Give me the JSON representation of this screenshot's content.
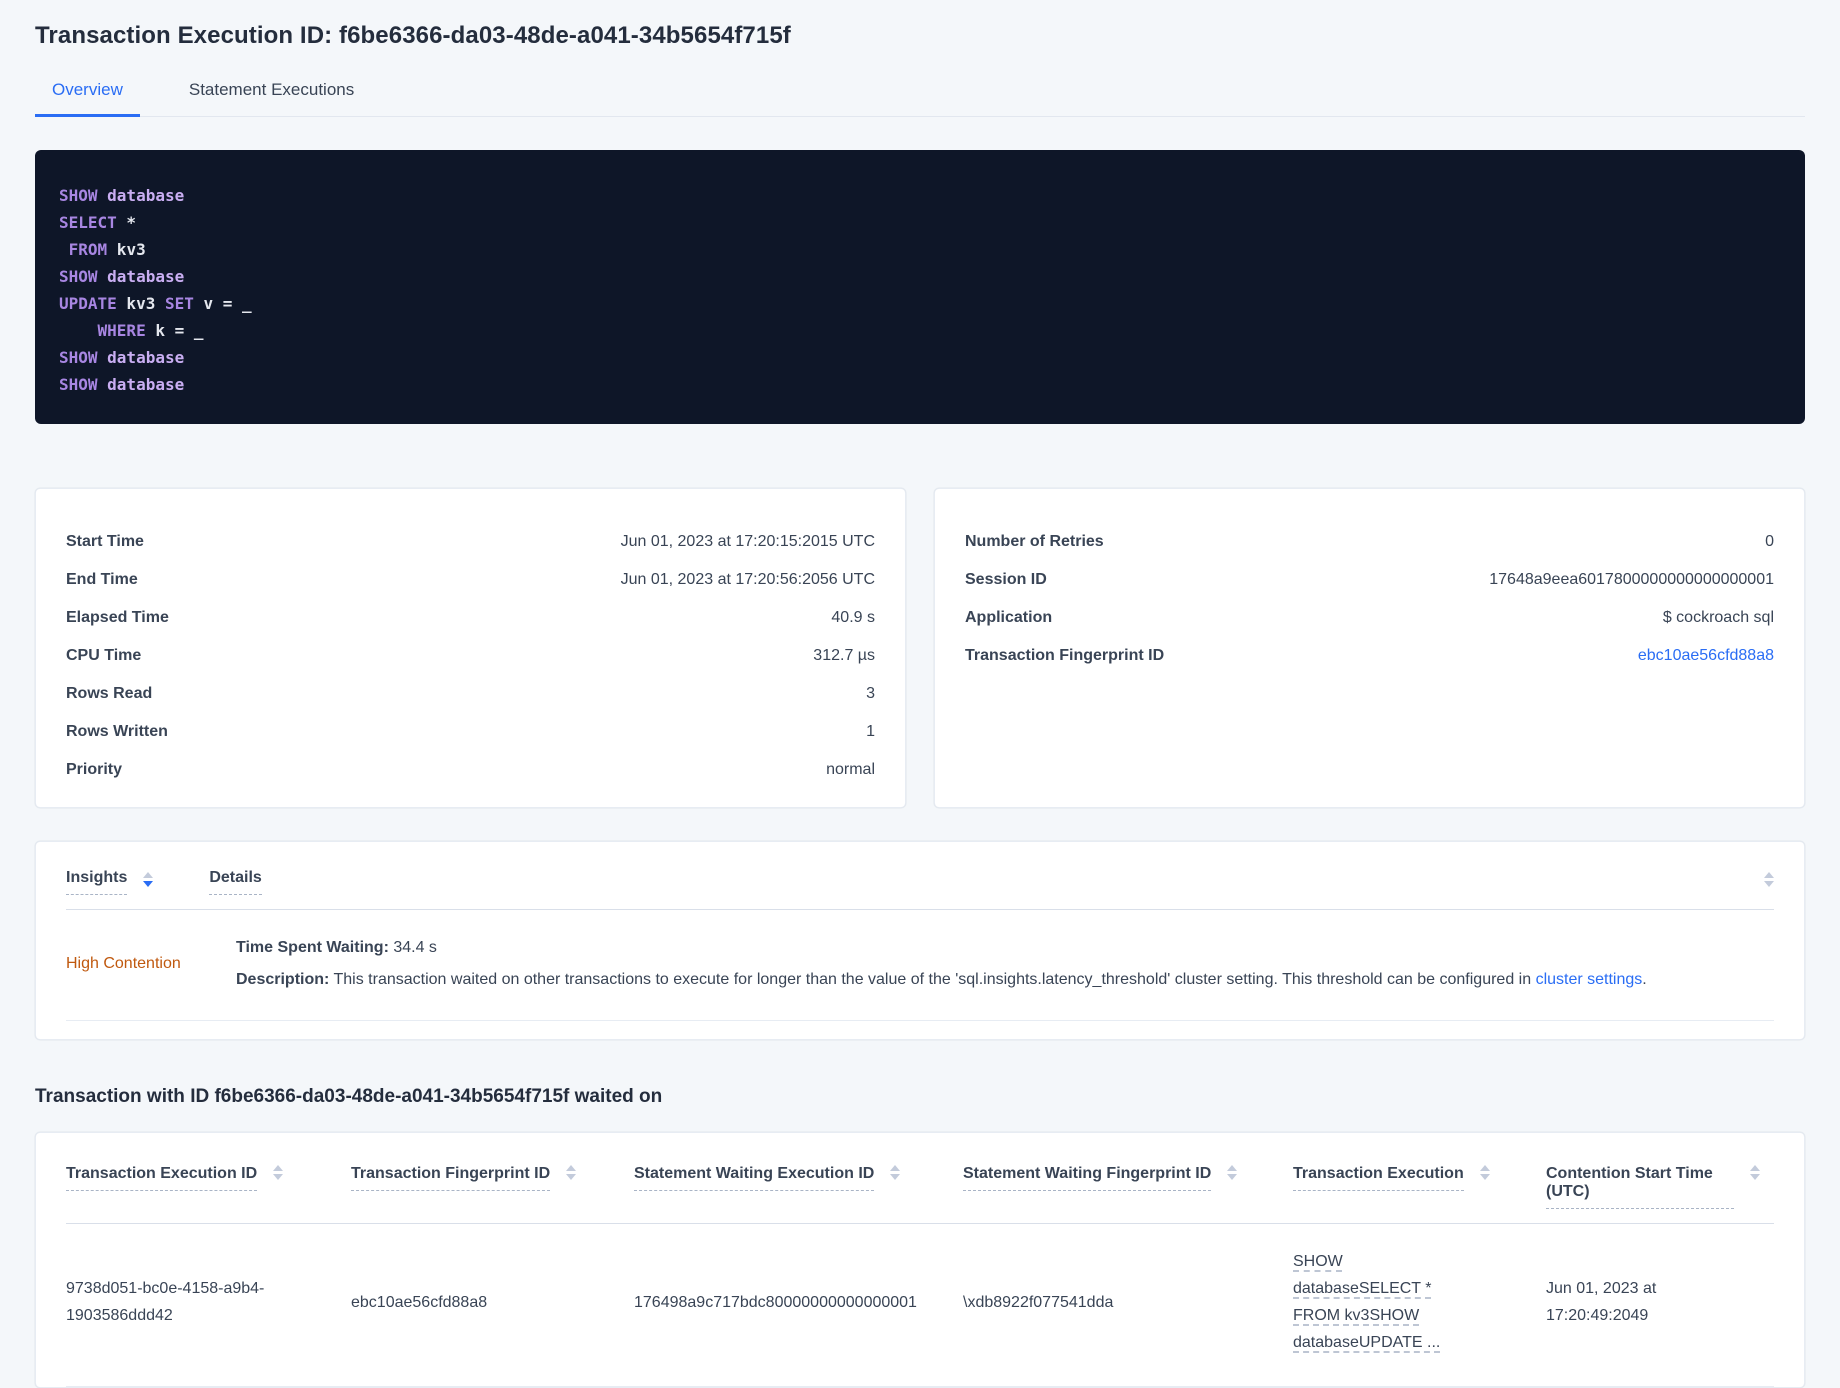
{
  "header": {
    "title": "Transaction Execution ID: f6be6366-da03-48de-a041-34b5654f715f"
  },
  "tabs": {
    "overview": "Overview",
    "statement_executions": "Statement Executions"
  },
  "colors": {
    "accent_blue": "#2a6df4",
    "insight_orange": "#c0590f",
    "code_background": "#0e1628",
    "code_keyword": "#a886e2",
    "code_database_word": "#c9aef2",
    "code_identifier": "#e4e7ee"
  },
  "sql_box": {
    "lines": [
      [
        {
          "c": "kw",
          "t": "SHOW"
        },
        {
          "c": "db",
          "t": " database"
        }
      ],
      [
        {
          "c": "kw",
          "t": "SELECT"
        },
        {
          "c": "id",
          "t": " *"
        }
      ],
      [
        {
          "c": "id",
          "t": " "
        },
        {
          "c": "kw",
          "t": "FROM"
        },
        {
          "c": "id",
          "t": " kv3"
        }
      ],
      [
        {
          "c": "kw",
          "t": "SHOW"
        },
        {
          "c": "db",
          "t": " database"
        }
      ],
      [
        {
          "c": "kw",
          "t": "UPDATE"
        },
        {
          "c": "id",
          "t": " kv3 "
        },
        {
          "c": "kw",
          "t": "SET"
        },
        {
          "c": "id",
          "t": " v = _"
        }
      ],
      [
        {
          "c": "id",
          "t": "    "
        },
        {
          "c": "kw",
          "t": "WHERE"
        },
        {
          "c": "id",
          "t": " k = _"
        }
      ],
      [
        {
          "c": "kw",
          "t": "SHOW"
        },
        {
          "c": "db",
          "t": " database"
        }
      ],
      [
        {
          "c": "kw",
          "t": "SHOW"
        },
        {
          "c": "db",
          "t": " database"
        }
      ]
    ]
  },
  "summary_left": {
    "rows": [
      {
        "label": "Start Time",
        "value": "Jun 01, 2023 at 17:20:15:2015 UTC"
      },
      {
        "label": "End Time",
        "value": "Jun 01, 2023 at 17:20:56:2056 UTC"
      },
      {
        "label": "Elapsed Time",
        "value": "40.9 s"
      },
      {
        "label": "CPU Time",
        "value": "312.7 µs"
      },
      {
        "label": "Rows Read",
        "value": "3"
      },
      {
        "label": "Rows Written",
        "value": "1"
      },
      {
        "label": "Priority",
        "value": "normal"
      }
    ]
  },
  "summary_right": {
    "rows": [
      {
        "label": "Number of Retries",
        "value": "0"
      },
      {
        "label": "Session ID",
        "value": "17648a9eea6017800000000000000001"
      },
      {
        "label": "Application",
        "value": "$ cockroach sql"
      },
      {
        "label": "Transaction Fingerprint ID",
        "value": "ebc10ae56cfd88a8"
      }
    ]
  },
  "insights_table": {
    "headers": {
      "insights": "Insights",
      "details": "Details"
    },
    "row": {
      "insight": "High Contention",
      "waiting_label": "Time Spent Waiting:",
      "waiting_value": " 34.4 s",
      "description_label": "Description:",
      "description_text": " This transaction waited on other transactions to execute for longer than the value of the 'sql.insights.latency_threshold' cluster setting. This threshold can be configured in ",
      "description_link": "cluster settings",
      "description_suffix": "."
    }
  },
  "waited_section": {
    "heading": "Transaction with ID f6be6366-da03-48de-a041-34b5654f715f waited on",
    "columns": [
      "Transaction Execution ID",
      "Transaction Fingerprint ID",
      "Statement Waiting Execution ID",
      "Statement Waiting Fingerprint ID",
      "Transaction Execution",
      "Contention Start Time (UTC)"
    ],
    "row": {
      "transaction_execution_id": "9738d051-bc0e-4158-a9b4-1903586ddd42",
      "transaction_fingerprint_id": "ebc10ae56cfd88a8",
      "statement_waiting_execution_id": "176498a9c717bdc80000000000000001",
      "statement_waiting_fingerprint_id": "\\xdb8922f077541dda",
      "transaction_execution": "SHOW databaseSELECT * FROM kv3SHOW databaseUPDATE ...",
      "contention_start_time": "Jun 01, 2023 at 17:20:49:2049"
    }
  }
}
